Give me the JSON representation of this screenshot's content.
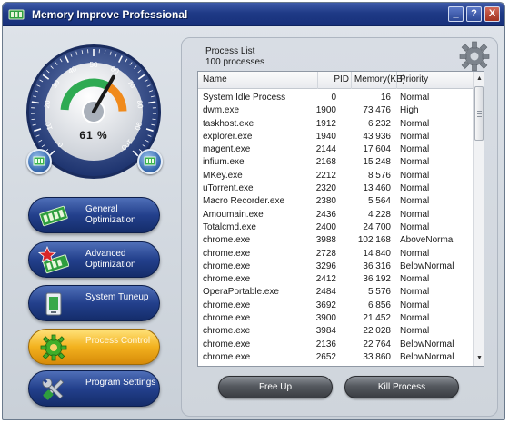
{
  "window": {
    "title": "Memory Improve Professional"
  },
  "titlebar_buttons": {
    "minimize": "_",
    "help": "?",
    "close": "X"
  },
  "gauge": {
    "value_text": "61 %",
    "level_percent": 61,
    "scale_labels": [
      "0",
      "10",
      "20",
      "30",
      "40",
      "50",
      "60",
      "70",
      "80",
      "90",
      "100"
    ]
  },
  "nav": [
    {
      "label": "General Optimization",
      "icon": "memory-chip-icon",
      "active": false
    },
    {
      "label": "Advanced Optimization",
      "icon": "star-chip-icon",
      "active": false
    },
    {
      "label": "System Tuneup",
      "icon": "device-icon",
      "active": false
    },
    {
      "label": "Process Control",
      "icon": "gear-icon",
      "active": true
    },
    {
      "label": "Program Settings",
      "icon": "tools-icon",
      "active": false
    }
  ],
  "process_list": {
    "title": "Process List",
    "count": "100 processes",
    "columns": {
      "name": "Name",
      "pid": "PID",
      "memory": "Memory(KB)",
      "priority": "Priority"
    },
    "rows": [
      {
        "name": "System Idle Process",
        "pid": "0",
        "memory": "16",
        "priority": "Normal"
      },
      {
        "name": "dwm.exe",
        "pid": "1900",
        "memory": "73 476",
        "priority": "High"
      },
      {
        "name": "taskhost.exe",
        "pid": "1912",
        "memory": "6 232",
        "priority": "Normal"
      },
      {
        "name": "explorer.exe",
        "pid": "1940",
        "memory": "43 936",
        "priority": "Normal"
      },
      {
        "name": "magent.exe",
        "pid": "2144",
        "memory": "17 604",
        "priority": "Normal"
      },
      {
        "name": "infium.exe",
        "pid": "2168",
        "memory": "15 248",
        "priority": "Normal"
      },
      {
        "name": "MKey.exe",
        "pid": "2212",
        "memory": "8 576",
        "priority": "Normal"
      },
      {
        "name": "uTorrent.exe",
        "pid": "2320",
        "memory": "13 460",
        "priority": "Normal"
      },
      {
        "name": "Macro Recorder.exe",
        "pid": "2380",
        "memory": "5 564",
        "priority": "Normal"
      },
      {
        "name": "Amoumain.exe",
        "pid": "2436",
        "memory": "4 228",
        "priority": "Normal"
      },
      {
        "name": "Totalcmd.exe",
        "pid": "2400",
        "memory": "24 700",
        "priority": "Normal"
      },
      {
        "name": "chrome.exe",
        "pid": "3988",
        "memory": "102 168",
        "priority": "AboveNormal"
      },
      {
        "name": "chrome.exe",
        "pid": "2728",
        "memory": "14 840",
        "priority": "Normal"
      },
      {
        "name": "chrome.exe",
        "pid": "3296",
        "memory": "36 316",
        "priority": "BelowNormal"
      },
      {
        "name": "chrome.exe",
        "pid": "2412",
        "memory": "36 192",
        "priority": "Normal"
      },
      {
        "name": "OperaPortable.exe",
        "pid": "2484",
        "memory": "5 576",
        "priority": "Normal"
      },
      {
        "name": "chrome.exe",
        "pid": "3692",
        "memory": "6 856",
        "priority": "Normal"
      },
      {
        "name": "chrome.exe",
        "pid": "3900",
        "memory": "21 452",
        "priority": "Normal"
      },
      {
        "name": "chrome.exe",
        "pid": "3984",
        "memory": "22 028",
        "priority": "Normal"
      },
      {
        "name": "chrome.exe",
        "pid": "2136",
        "memory": "22 764",
        "priority": "BelowNormal"
      },
      {
        "name": "chrome.exe",
        "pid": "2652",
        "memory": "33 860",
        "priority": "BelowNormal"
      }
    ]
  },
  "actions": {
    "free_up": "Free Up",
    "kill_process": "Kill Process"
  },
  "colors": {
    "titlebar": "#1f3a86",
    "nav_button": "#23408c",
    "nav_active": "#f3b21f",
    "gauge_green": "#2eaa52",
    "gauge_orange": "#f08a1c",
    "action_button": "#4a4e54"
  }
}
